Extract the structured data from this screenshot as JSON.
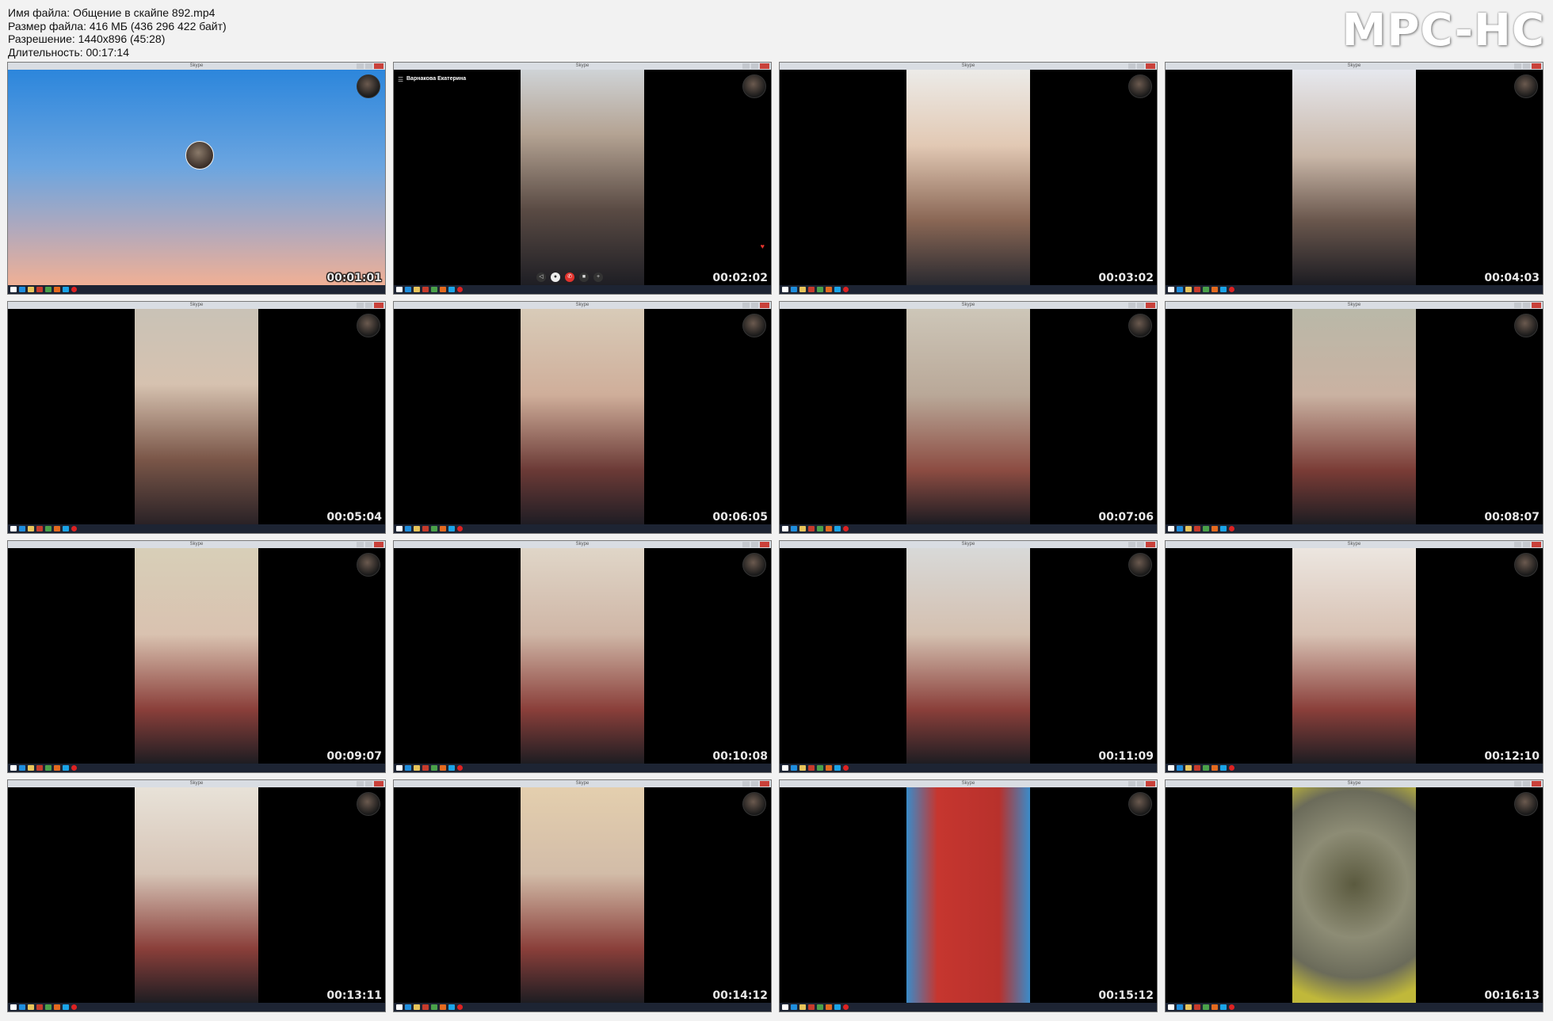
{
  "header": {
    "filename": "Имя файла: Общение в скайпе 892.mp4",
    "filesize": "Размер файла: 416 МБ (436 296 422 байт)",
    "resolution": "Разрешение: 1440x896 (45:28)",
    "duration": "Длительность: 00:17:14"
  },
  "logo": "MPC-HC",
  "window_title": "Skype",
  "call": {
    "contact_name": "Варнакова Екатерина"
  },
  "thumbnails": [
    {
      "time": "00:01:01"
    },
    {
      "time": "00:02:02"
    },
    {
      "time": "00:03:02"
    },
    {
      "time": "00:04:03"
    },
    {
      "time": "00:05:04"
    },
    {
      "time": "00:06:05"
    },
    {
      "time": "00:07:06"
    },
    {
      "time": "00:08:07"
    },
    {
      "time": "00:09:07"
    },
    {
      "time": "00:10:08"
    },
    {
      "time": "00:11:09"
    },
    {
      "time": "00:12:10"
    },
    {
      "time": "00:13:11"
    },
    {
      "time": "00:14:12"
    },
    {
      "time": "00:15:12"
    },
    {
      "time": "00:16:13"
    }
  ],
  "icons": {
    "taskbar": [
      "windows-start-icon",
      "ie-icon",
      "folder-icon",
      "app-icon",
      "chrome-icon",
      "firefox-icon",
      "skype-icon",
      "record-icon"
    ]
  },
  "colors": {
    "end_call": "#e2332d",
    "window_close": "#c9413a",
    "taskbar": "#1d2433"
  }
}
